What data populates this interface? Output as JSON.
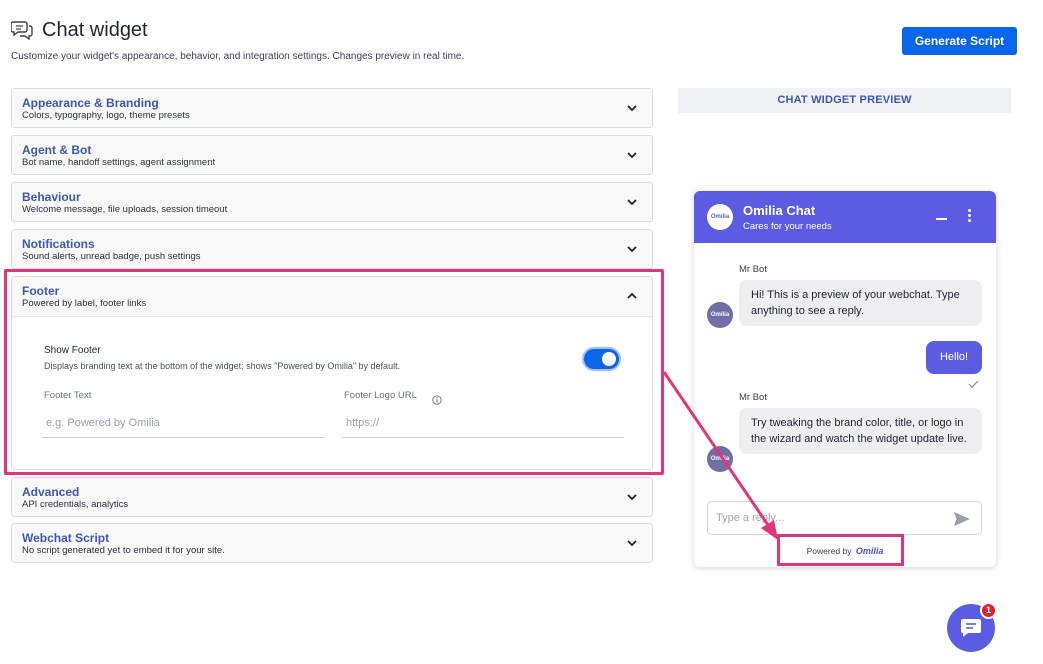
{
  "header": {
    "title": "Chat widget",
    "subtitle": "Customize your widget's appearance, behavior, and integration settings. Changes preview in real time.",
    "icon": "chat-bubbles-icon",
    "generate_label": "Generate Script"
  },
  "sections": [
    {
      "title": "Appearance & Branding",
      "desc": "Colors, typography, logo, theme presets"
    },
    {
      "title": "Agent & Bot",
      "desc": "Bot name, handoff settings, agent assignment"
    },
    {
      "title": "Behaviour",
      "desc": "Welcome message, file uploads, session timeout"
    },
    {
      "title": "Notifications",
      "desc": "Sound alerts, unread badge, push settings"
    },
    {
      "title": "Footer",
      "desc": "Powered by label, footer links"
    },
    {
      "title": "Advanced",
      "desc": "API credentials, analytics"
    },
    {
      "title": "Webchat Script",
      "desc": "No script generated yet to embed it for your site."
    }
  ],
  "footer_settings": {
    "show_footer_label": "Show Footer",
    "show_footer_desc": "Displays branding text at the bottom of the widget; shows \"Powered by Omilia\" by default.",
    "show_footer_enabled": true,
    "footer_text_label": "Footer Text",
    "footer_text_placeholder": "e.g. Powered by Omilia",
    "footer_text_value": "",
    "footer_logo_label": "Footer Logo URL",
    "footer_logo_placeholder": "https://",
    "footer_logo_value": ""
  },
  "preview": {
    "tab_label": "CHAT WIDGET PREVIEW",
    "widget": {
      "logo_text": "Omilia",
      "title": "Omilia Chat",
      "subtitle": "Cares for your needs",
      "header_color": "#5b5ce2",
      "messages": [
        {
          "from": "bot",
          "sender": "Mr Bot",
          "text": "Hi! This is a preview of your webchat. Type anything to see a reply."
        },
        {
          "from": "user",
          "text": "Hello!"
        },
        {
          "from": "bot",
          "sender": "Mr Bot",
          "text": "Try tweaking the brand color, title, or logo in the wizard and watch the widget update live."
        }
      ],
      "reply_placeholder": "Type a reply...",
      "powered_by_label": "Powered by",
      "powered_by_brand": "Omilia"
    }
  },
  "launcher": {
    "badge_count": "1"
  },
  "colors": {
    "accent": "#0a66e8",
    "section_title": "#3d57b5",
    "highlight": "#e0357a",
    "widget_primary": "#5b5ce2"
  }
}
